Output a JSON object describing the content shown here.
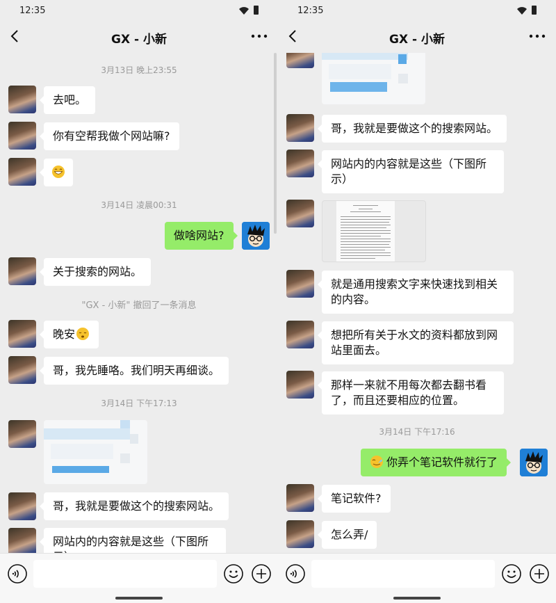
{
  "status": {
    "time": "12:35"
  },
  "chat": {
    "title": "GX - 小新"
  },
  "input": {
    "placeholder": ""
  },
  "left": {
    "ts1": "3月13日 晚上23:55",
    "ts2": "3月14日 凌晨00:31",
    "ts3": "3月14日 下午17:13",
    "recall": "\"GX - 小新\" 撤回了一条消息",
    "m1": "去吧。",
    "m2": "你有空帮我做个网站嘛?",
    "m4": "做啥网站?",
    "m5": "关于搜索的网站。",
    "m6": "晚安",
    "m7": "哥，我先睡咯。我们明天再细谈。",
    "m9": "哥，我就是要做这个的搜索网站。",
    "m10": "网站内的内容就是这些（下图所示）"
  },
  "right": {
    "m1": "哥，我就是要做这个的搜索网站。",
    "m2": "网站内的内容就是这些（下图所示）",
    "m4": "就是通用搜索文字来快速找到相关的内容。",
    "m5": "想把所有关于水文的资料都放到网站里面去。",
    "m6": "那样一来就不用每次都去翻书看了，而且还要相应的位置。",
    "ts": "3月14日 下午17:16",
    "m7": "你弄个笔记软件就行了",
    "m8": "笔记软件?",
    "m9": "怎么弄/"
  },
  "icons": {
    "back": "chevron-left-icon",
    "more": "more-dots-icon",
    "voice": "voice-icon",
    "emoji": "emoji-icon",
    "plus": "plus-icon"
  },
  "colors": {
    "background": "#ededed",
    "bubble_in": "#ffffff",
    "bubble_out": "#95ec69",
    "timestamp": "#999999"
  }
}
